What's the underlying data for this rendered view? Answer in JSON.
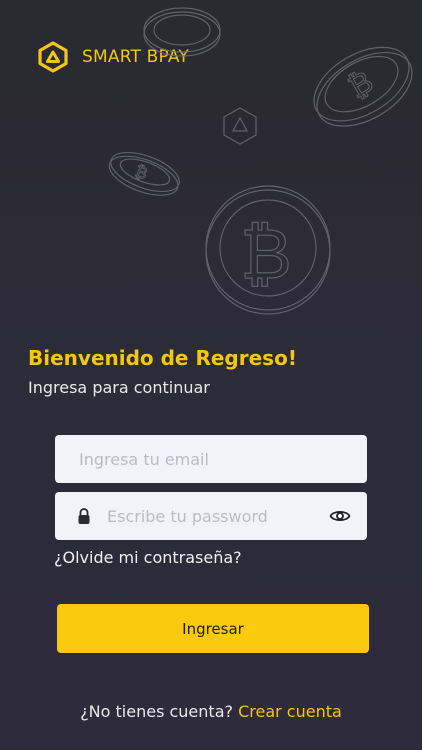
{
  "brand": {
    "name": "SMART BPAY",
    "accent_color": "#f5c518",
    "logo_icon": "hexagon-logo-icon"
  },
  "illustration": {
    "icon": "bitcoin-coins-illustration"
  },
  "login": {
    "title": "Bienvenido de Regreso!",
    "subtitle": "Ingresa para continuar",
    "email_placeholder": "Ingresa tu email",
    "password_placeholder": "Escribe tu password",
    "password_icon": "lock-icon",
    "toggle_icon": "eye-icon",
    "forgot_label": "¿Olvide mi contraseña?",
    "submit_label": "Ingresar",
    "button_color": "#f9ca0e"
  },
  "signup": {
    "prompt": "¿No tienes cuenta?",
    "link_label": "Crear cuenta"
  }
}
